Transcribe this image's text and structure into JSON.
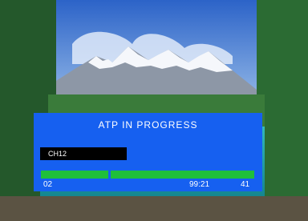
{
  "osd": {
    "title": "ATP IN PROGRESS",
    "channel": "CH12",
    "progress_start": "02",
    "progress_value": "99:21",
    "progress_end": "41"
  },
  "background": {
    "sky_color": "#3f78d0",
    "forest_color": "#2e6a2f",
    "lake_color": "#1aa2a6"
  }
}
